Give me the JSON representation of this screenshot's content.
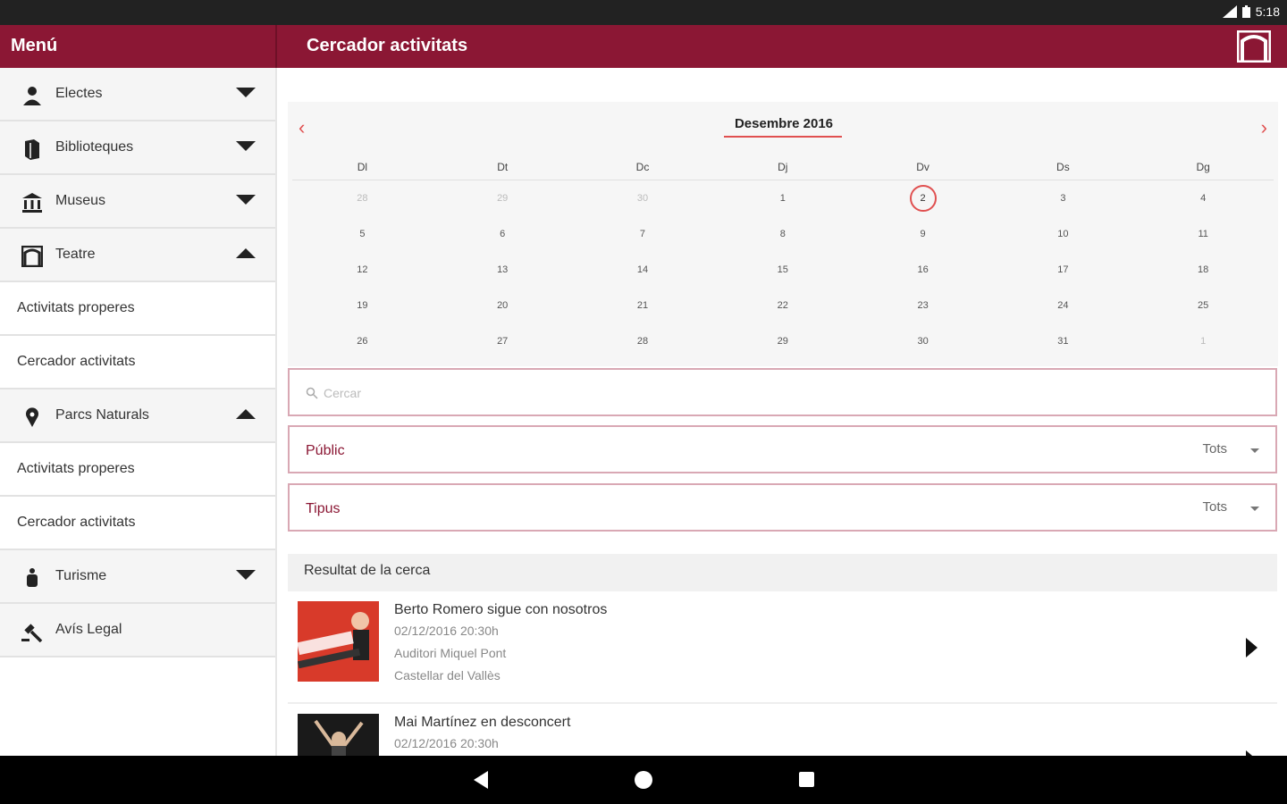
{
  "status": {
    "time": "5:18"
  },
  "appbar": {
    "menu_title": "Menú",
    "screen_title": "Cercador activitats"
  },
  "sidebar": {
    "items": [
      {
        "label": "Electes",
        "icon": "person-icon"
      },
      {
        "label": "Biblioteques",
        "icon": "book-icon"
      },
      {
        "label": "Museus",
        "icon": "museum-icon"
      },
      {
        "label": "Teatre",
        "icon": "theatre-icon"
      },
      {
        "label": "Activitats properes"
      },
      {
        "label": "Cercador activitats"
      },
      {
        "label": "Parcs Naturals",
        "icon": "pin-icon"
      },
      {
        "label": "Activitats properes"
      },
      {
        "label": "Cercador activitats"
      },
      {
        "label": "Turisme",
        "icon": "tourism-icon"
      },
      {
        "label": "Avís Legal",
        "icon": "gavel-icon"
      }
    ]
  },
  "calendar": {
    "month": "Desembre 2016",
    "weekdays": [
      "Dl",
      "Dt",
      "Dc",
      "Dj",
      "Dv",
      "Ds",
      "Dg"
    ],
    "weeks": [
      [
        "28",
        "29",
        "30",
        "1",
        "2",
        "3",
        "4"
      ],
      [
        "5",
        "6",
        "7",
        "8",
        "9",
        "10",
        "11"
      ],
      [
        "12",
        "13",
        "14",
        "15",
        "16",
        "17",
        "18"
      ],
      [
        "19",
        "20",
        "21",
        "22",
        "23",
        "24",
        "25"
      ],
      [
        "26",
        "27",
        "28",
        "29",
        "30",
        "31",
        "1"
      ]
    ]
  },
  "search": {
    "placeholder": "Cercar"
  },
  "filters": {
    "public": {
      "label": "Públic",
      "value": "Tots"
    },
    "type": {
      "label": "Tipus",
      "value": "Tots"
    }
  },
  "results": {
    "heading": "Resultat de la cerca",
    "items": [
      {
        "title": "Berto Romero sigue con nosotros",
        "date": "02/12/2016 20:30h",
        "venue": "Auditori Miquel Pont",
        "city": "Castellar del Vallès"
      },
      {
        "title": "Mai Martínez en desconcert",
        "date": "02/12/2016 20:30h"
      }
    ]
  },
  "colors": {
    "brand": "#8b1734",
    "accent": "#e05050"
  }
}
